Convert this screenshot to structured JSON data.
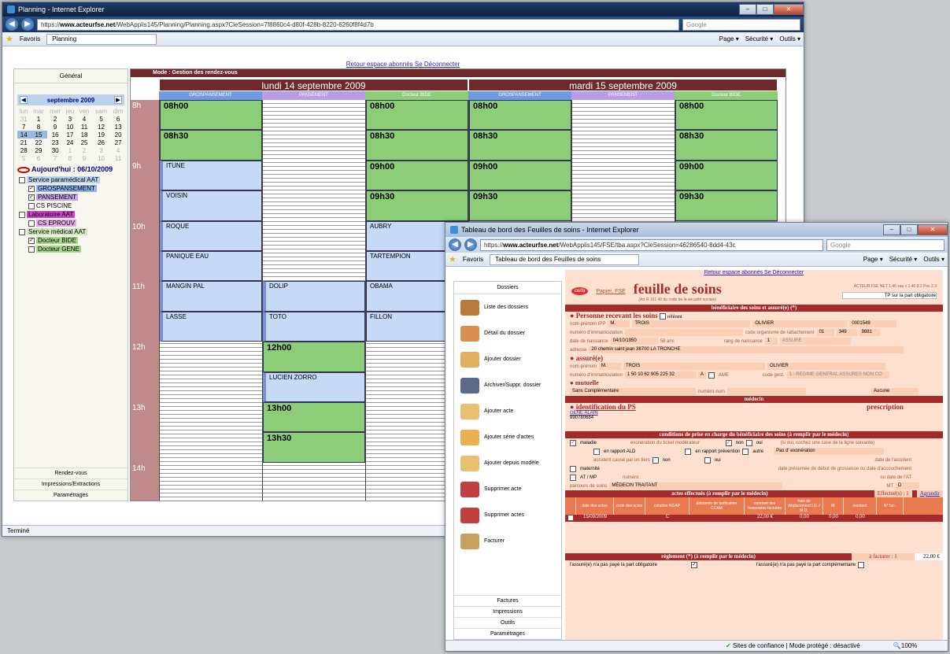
{
  "planning": {
    "window_title": "Planning - Internet Explorer",
    "url_prefix": "https://",
    "url_domain": "www.acteurfse.net",
    "url_rest": "/WebApplis145/Planning/Planning.aspx?CleSession=7f8860c4-d80f-428b-8220-6260f8f4d7b",
    "search_placeholder": "Google",
    "favorites_label": "Favoris",
    "tab_label": "Planning",
    "tools": [
      "Page ▾",
      "Sécurité ▾",
      "Outils ▾"
    ],
    "top_links": "Retour espace abonnés Se Déconnecter",
    "left": {
      "heading": "Général",
      "month": "septembre 2009",
      "weekdays": [
        "lun",
        "mar",
        "mer",
        "jeu",
        "ven",
        "sam",
        "dim"
      ],
      "weeks": [
        [
          [
            "31",
            1
          ],
          [
            "1",
            0
          ],
          [
            "2",
            0
          ],
          [
            "3",
            0
          ],
          [
            "4",
            0
          ],
          [
            "5",
            0
          ],
          [
            "6",
            0
          ]
        ],
        [
          [
            "7",
            0
          ],
          [
            "8",
            0
          ],
          [
            "9",
            0
          ],
          [
            "10",
            0
          ],
          [
            "11",
            0
          ],
          [
            "12",
            0
          ],
          [
            "13",
            0
          ]
        ],
        [
          [
            "14",
            2
          ],
          [
            "15",
            2
          ],
          [
            "16",
            0
          ],
          [
            "17",
            0
          ],
          [
            "18",
            0
          ],
          [
            "19",
            0
          ],
          [
            "20",
            0
          ]
        ],
        [
          [
            "21",
            0
          ],
          [
            "22",
            0
          ],
          [
            "23",
            0
          ],
          [
            "24",
            0
          ],
          [
            "25",
            0
          ],
          [
            "26",
            0
          ],
          [
            "27",
            0
          ]
        ],
        [
          [
            "28",
            0
          ],
          [
            "29",
            0
          ],
          [
            "30",
            0
          ],
          [
            "1",
            1
          ],
          [
            "2",
            1
          ],
          [
            "3",
            1
          ],
          [
            "4",
            1
          ]
        ],
        [
          [
            "5",
            1
          ],
          [
            "6",
            1
          ],
          [
            "7",
            1
          ],
          [
            "8",
            1
          ],
          [
            "9",
            1
          ],
          [
            "10",
            1
          ],
          [
            "11",
            1
          ]
        ]
      ],
      "today": "Aujourd'hui : 06/10/2009",
      "tree": [
        {
          "label": "Service paramédical AAT",
          "level": 0,
          "checked": false,
          "color": "#bcd3ef"
        },
        {
          "label": "GROSPANSEMENT",
          "level": 1,
          "checked": true,
          "color": "#8fb3e8"
        },
        {
          "label": "PANSEMENT",
          "level": 1,
          "checked": true,
          "color": "#c8a8e8"
        },
        {
          "label": "CS PISCINE",
          "level": 1,
          "checked": false,
          "color": ""
        },
        {
          "label": "Laboratoire AAT",
          "level": 0,
          "checked": false,
          "color": "#cc44cc"
        },
        {
          "label": "CS EPROUV",
          "level": 1,
          "checked": false,
          "color": "#e8a8e8"
        },
        {
          "label": "Service médical AAT",
          "level": 0,
          "checked": false,
          "color": "#cfe8c0"
        },
        {
          "label": "Docteur BIDE",
          "level": 1,
          "checked": true,
          "color": "#a8d890"
        },
        {
          "label": "Docteur GENE",
          "level": 1,
          "checked": false,
          "color": "#a8d890"
        }
      ],
      "bottom": [
        "Rendez-vous",
        "Impressions/Extractions",
        "Paramétrages"
      ]
    },
    "grid_top": "Mode : Gestion des rendez-vous",
    "days": [
      "lundi 14 septembre 2009",
      "mardi 15 septembre 2009"
    ],
    "columns": [
      "GROSPANSEMENT",
      "PANSEMENT",
      "Docteur BIDE",
      "GROSPANSEMENT",
      "PANSEMENT",
      "Docteur BIDE"
    ],
    "hours": [
      "8h",
      "9h",
      "10h",
      "11h",
      "12h",
      "13h",
      "14h"
    ],
    "events": [
      {
        "col": 0,
        "slot": 0,
        "len": 2,
        "text": "08h00",
        "kind": "g"
      },
      {
        "col": 0,
        "slot": 2,
        "len": 2,
        "text": "08h30",
        "kind": "g"
      },
      {
        "col": 0,
        "slot": 4,
        "len": 2,
        "text": "ITUNE",
        "kind": "b2"
      },
      {
        "col": 0,
        "slot": 6,
        "len": 2,
        "text": "VOISIN",
        "kind": "b2"
      },
      {
        "col": 0,
        "slot": 8,
        "len": 2,
        "text": "ROQUE",
        "kind": "b2"
      },
      {
        "col": 0,
        "slot": 10,
        "len": 2,
        "text": "PANIQUE EAU",
        "kind": "b2"
      },
      {
        "col": 0,
        "slot": 12,
        "len": 2,
        "text": "MANGIN PAL",
        "kind": "b2"
      },
      {
        "col": 0,
        "slot": 14,
        "len": 2,
        "text": "LASSE",
        "kind": "b2"
      },
      {
        "col": 1,
        "slot": 12,
        "len": 2,
        "text": "DOLIP",
        "kind": "b2"
      },
      {
        "col": 1,
        "slot": 14,
        "len": 2,
        "text": "TOTO",
        "kind": "b2"
      },
      {
        "col": 1,
        "slot": 16,
        "len": 2,
        "text": "12h00",
        "kind": "g"
      },
      {
        "col": 1,
        "slot": 18,
        "len": 2,
        "text": "LUCIEN ZORRO",
        "kind": "b2"
      },
      {
        "col": 1,
        "slot": 20,
        "len": 2,
        "text": "13h00",
        "kind": "g"
      },
      {
        "col": 1,
        "slot": 22,
        "len": 2,
        "text": "13h30",
        "kind": "g"
      },
      {
        "col": 2,
        "slot": 0,
        "len": 2,
        "text": "08h00",
        "kind": "g"
      },
      {
        "col": 2,
        "slot": 2,
        "len": 2,
        "text": "08h30",
        "kind": "g"
      },
      {
        "col": 2,
        "slot": 4,
        "len": 2,
        "text": "09h00",
        "kind": "g"
      },
      {
        "col": 2,
        "slot": 6,
        "len": 2,
        "text": "09h30",
        "kind": "g"
      },
      {
        "col": 2,
        "slot": 8,
        "len": 2,
        "text": "AUBRY",
        "kind": "b"
      },
      {
        "col": 2,
        "slot": 10,
        "len": 2,
        "text": "TARTEMPION",
        "kind": "b"
      },
      {
        "col": 2,
        "slot": 12,
        "len": 2,
        "text": "OBAMA",
        "kind": "b"
      },
      {
        "col": 2,
        "slot": 14,
        "len": 2,
        "text": "FILLON",
        "kind": "b"
      },
      {
        "col": 3,
        "slot": 0,
        "len": 2,
        "text": "08h00",
        "kind": "g"
      },
      {
        "col": 3,
        "slot": 2,
        "len": 2,
        "text": "08h30",
        "kind": "g"
      },
      {
        "col": 3,
        "slot": 4,
        "len": 2,
        "text": "09h00",
        "kind": "g"
      },
      {
        "col": 3,
        "slot": 6,
        "len": 2,
        "text": "09h30",
        "kind": "g"
      },
      {
        "col": 5,
        "slot": 0,
        "len": 2,
        "text": "08h00",
        "kind": "g"
      },
      {
        "col": 5,
        "slot": 2,
        "len": 2,
        "text": "08h30",
        "kind": "g"
      },
      {
        "col": 5,
        "slot": 4,
        "len": 2,
        "text": "09h00",
        "kind": "g"
      },
      {
        "col": 5,
        "slot": 6,
        "len": 2,
        "text": "09h30",
        "kind": "g"
      }
    ],
    "status": "Terminé"
  },
  "feuille": {
    "window_title": "Tableau de bord des Feuilles de soins - Internet Explorer",
    "url_prefix": "https://",
    "url_domain": "www.acteurfse.net",
    "url_rest": "/WebApplis145/FSE/tba.aspx?CleSession=46286540-8dd4-43c",
    "search_placeholder": "Google",
    "favorites_label": "Favoris",
    "tab_label": "Tableau de bord des Feuilles de soins",
    "tools": [
      "Page ▾",
      "Sécurité ▾",
      "Outils ▾"
    ],
    "left_heading": "Dossiers",
    "menu": [
      {
        "label": "Liste des dossiers",
        "color": "#b87a3a"
      },
      {
        "label": "Détail du dossier",
        "color": "#d89050"
      },
      {
        "label": "Ajouter dossier",
        "color": "#e0b060"
      },
      {
        "label": "Archiver/Suppr. dossier",
        "color": "#5a6a8a"
      },
      {
        "label": "Ajouter acte",
        "color": "#e8c070"
      },
      {
        "label": "Ajouter série d'actes",
        "color": "#e8b050"
      },
      {
        "label": "Ajouter depuis modèle",
        "color": "#e8c070"
      },
      {
        "label": "Supprimer acte",
        "color": "#c04040"
      },
      {
        "label": "Supprimer actes",
        "color": "#c04040"
      },
      {
        "label": "Facturer",
        "color": "#c8a060"
      }
    ],
    "left_footer": [
      "Factures",
      "Impressions",
      "Outils",
      "Paramétrages"
    ],
    "links": "Retour espace abonnés Se Déconnecter",
    "cerfa": "cerfa",
    "papier": "Papier, FSE",
    "title": "feuille de soins",
    "subtitle": "(Art R 161 40 du code de la sécurité sociale)",
    "version": "ACTEUR FSE NET 1.46 sau v 1.40.8.2 Pos 2.3",
    "tp": "TP sur la part obligatoire",
    "section1": "bénéficiaire des soins et assuré(e) (*)",
    "personne": "Personne recevant les soins",
    "referent": "référent",
    "beneficiaire": {
      "nom_label": "nom-prénom IPP",
      "civ": "M.",
      "nom": "TROIS",
      "prenom": "OLIVIER",
      "ipp": "0001549",
      "immat_label": "numéro d'immatriculation",
      "organisme_label": "code organisme de rattachement",
      "org1": "01",
      "org2": "349",
      "org3": "9881",
      "naissance_label": "date de naissance",
      "naissance": "04/10/1950",
      "age": "58 ans",
      "rang_label": "rang de naissance",
      "rang": "1",
      "assure": "ASSURE",
      "adresse_label": "adresse",
      "adresse": "20 chemin saint jean  38700 LA TRONCHE"
    },
    "assure_title": "assuré(e)",
    "assure": {
      "nom_label": "nom-prénom",
      "civ": "M.",
      "nom": "TROIS",
      "prenom": "OLIVIER",
      "immat_label": "numéro d'immatriculation",
      "immat": "1 50 10 62 905 225 32",
      "cle": "A",
      "ame": "AME",
      "gest_label": "code gest.",
      "gest": "1 - REGIME GENERAL ASSURES NON CO"
    },
    "mutuelle_title": "mutuelle",
    "mutuelle": "Sans Complémentaire",
    "numero_nom": "numéro-nom",
    "aucune": "Aucune",
    "section_medecin": "médecin",
    "identification": "identification du PS",
    "prescription": "prescription",
    "ps_name": "GENE ALAIN",
    "ps_num": "990780684",
    "section_conditions": "conditions de prise en charge du bénéficiaire des soins (à remplir par le médecin)",
    "conditions": {
      "maladie": "maladie",
      "exoneration": "exonération du ticket modérateur",
      "non": "non",
      "oui": "oui",
      "note": "(si oui, cochez une case de la ligne suivante)",
      "ald": "en rapport ALD",
      "prevention": "en rapport prévention",
      "autre": "autre",
      "pas_exo": "Pas d' exonération",
      "accident": "accident causé par un tiers",
      "date_accident": "date de l'accident",
      "maternite": "maternité",
      "grossesse": "date présumée de début de grossesse ou date d'accouchement",
      "at_mp": "AT / MP",
      "numero": "numéro",
      "date_at": "ou date de l'AT",
      "parcours_label": "parcours de soins",
      "parcours": "MÉDECIN TRAITANT",
      "mt": "MT",
      "mt_val": "D"
    },
    "section_actes": "actes effectués (à remplir par le médecin)",
    "effectues": "Effectué(s) : 1",
    "agrandir": "Agrandir",
    "acts_columns": [
      "date des actes",
      "code des actes",
      "cotation NGAP",
      "éléments de tarification CCAM",
      "montant des honoraires facturés",
      "frais de déplacement I.D. / M.D.",
      "IK",
      "montant",
      "N° fac."
    ],
    "act_row": [
      "15/09/2009",
      "",
      "C",
      "",
      "22,00 €",
      "0,00",
      "0,00",
      "0,00",
      ""
    ],
    "section_reglement": "règlement (*) (à remplir par le médecin)",
    "a_facturer": "à facturer : 1",
    "total": "22,00 €",
    "reg1": "l'assuré(e) n'a pas payé la part obligatoire",
    "reg2": "l'assuré(e) n'a pas payé la part complémentaire",
    "status_right": "Sites de confiance | Mode protégé : désactivé",
    "zoom": "100%"
  }
}
